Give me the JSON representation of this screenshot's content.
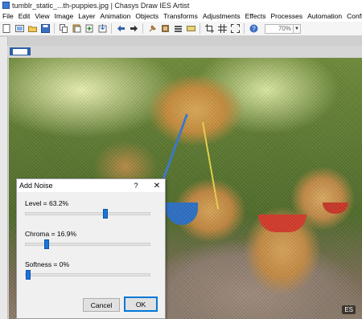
{
  "window": {
    "title": "tumblr_static_...th-puppies.jpg | Chasys Draw IES Artist"
  },
  "menu": [
    {
      "label": "File"
    },
    {
      "label": "Edit"
    },
    {
      "label": "View"
    },
    {
      "label": "Image"
    },
    {
      "label": "Layer"
    },
    {
      "label": "Animation"
    },
    {
      "label": "Objects"
    },
    {
      "label": "Transforms"
    },
    {
      "label": "Adjustments"
    },
    {
      "label": "Effects"
    },
    {
      "label": "Processes"
    },
    {
      "label": "Automation"
    },
    {
      "label": "Configure"
    }
  ],
  "toolbar": {
    "zoom_value": "70%",
    "icons": [
      "new-file-icon",
      "new-image-icon",
      "open-icon",
      "save-icon",
      "copy-icon",
      "paste-icon",
      "paste-new-icon",
      "import-icon",
      "undo-icon",
      "redo-icon",
      "pin-icon",
      "layers-icon",
      "stack-icon",
      "grid-toggle-icon",
      "crop-icon",
      "grid-icon",
      "fullscreen-icon",
      "help-icon"
    ]
  },
  "canvas": {
    "watermark": "ES"
  },
  "dialog": {
    "title": "Add Noise",
    "help_label": "?",
    "close_label": "✕",
    "level": {
      "label": "Level = 63.2%",
      "value": 0.632
    },
    "chroma": {
      "label": "Chroma = 16.9%",
      "value": 0.169
    },
    "softness": {
      "label": "Softness = 0%",
      "value": 0.0
    },
    "cancel_label": "Cancel",
    "ok_label": "OK"
  },
  "colors": {
    "accent": "#1a73d9",
    "ok_border": "#0078d7"
  }
}
